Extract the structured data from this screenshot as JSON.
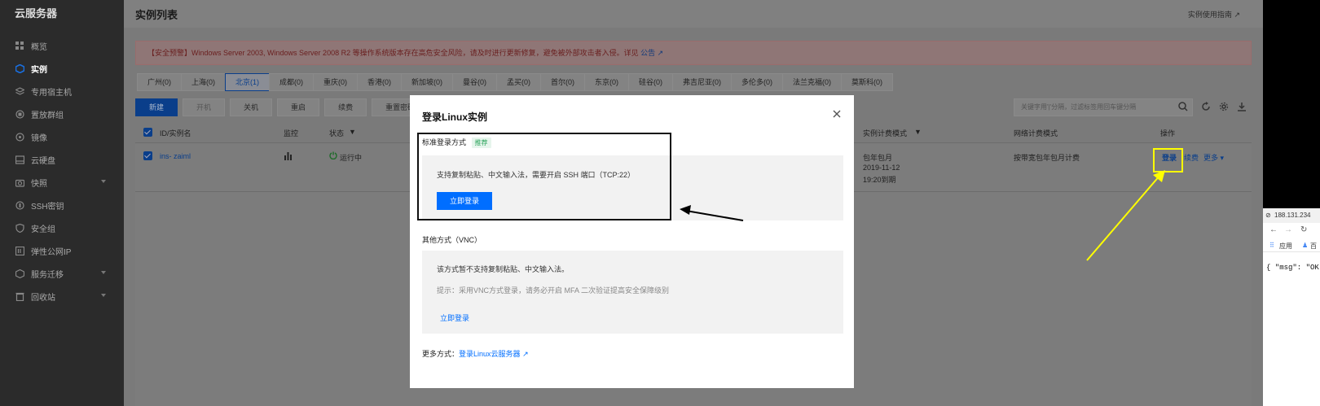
{
  "sidebar": {
    "brand": "云服务器",
    "items": [
      {
        "label": "概览"
      },
      {
        "label": "实例"
      },
      {
        "label": "专用宿主机"
      },
      {
        "label": "置放群组"
      },
      {
        "label": "镜像"
      },
      {
        "label": "云硬盘"
      },
      {
        "label": "快照"
      },
      {
        "label": "SSH密钥"
      },
      {
        "label": "安全组"
      },
      {
        "label": "弹性公网IP"
      },
      {
        "label": "服务迁移"
      },
      {
        "label": "回收站"
      }
    ]
  },
  "header": {
    "title": "实例列表",
    "guide": "实例使用指南"
  },
  "alert": {
    "text": "【安全预警】Windows Server 2003, Windows Server 2008 R2 等操作系统版本存在高危安全风险，请及时进行更新修复，避免被外部攻击者入侵。详见",
    "link": "公告"
  },
  "regions": [
    "广州(0)",
    "上海(0)",
    "北京(1)",
    "成都(0)",
    "重庆(0)",
    "香港(0)",
    "新加坡(0)",
    "曼谷(0)",
    "孟买(0)",
    "首尔(0)",
    "东京(0)",
    "硅谷(0)",
    "弗吉尼亚(0)",
    "多伦多(0)",
    "法兰克福(0)",
    "莫斯科(0)"
  ],
  "toolbar": {
    "new": "新建",
    "start": "开机",
    "stop": "关机",
    "restart": "重启",
    "renew": "续费",
    "reset": "重置密码",
    "search_placeholder": "关键字用'|'分隔，过滤标签用回车键分隔"
  },
  "table": {
    "headers": {
      "id": "ID/实例名",
      "monitor": "监控",
      "status": "状态",
      "billing": "实例计费模式",
      "network": "网络计费模式",
      "ops": "操作"
    },
    "row": {
      "id": "ins-   zaiml",
      "status": "运行中",
      "billing_mode": "包年包月",
      "billing_date": "2019-11-12",
      "billing_expire": "19:20到期",
      "network_mode": "按带宽包年包月计费",
      "login": "登录",
      "renew": "续费",
      "more": "更多"
    }
  },
  "modal": {
    "title": "登录Linux实例",
    "standard_label": "标准登录方式",
    "recommend": "推荐",
    "standard_desc": "支持复制粘贴、中文输入法，需要开启 SSH 端口（TCP:22）",
    "standard_button": "立即登录",
    "other_label": "其他方式（VNC）",
    "vnc_desc": "该方式暂不支持复制粘贴、中文输入法。",
    "vnc_hint": "提示：采用VNC方式登录，请务必开启 MFA 二次验证提高安全保障级别",
    "vnc_button": "立即登录",
    "more_prefix": "更多方式：",
    "more_link": "登录Linux云服务器"
  },
  "browser": {
    "address": "188.131.234",
    "bookmarks": "应用",
    "bookmarks2": "百",
    "json_text": "{ \"msg\": \"OK\""
  },
  "colors": {
    "primary": "#006eff",
    "highlight": "#ffff00",
    "sidebar_bg": "#2b2b2b"
  }
}
